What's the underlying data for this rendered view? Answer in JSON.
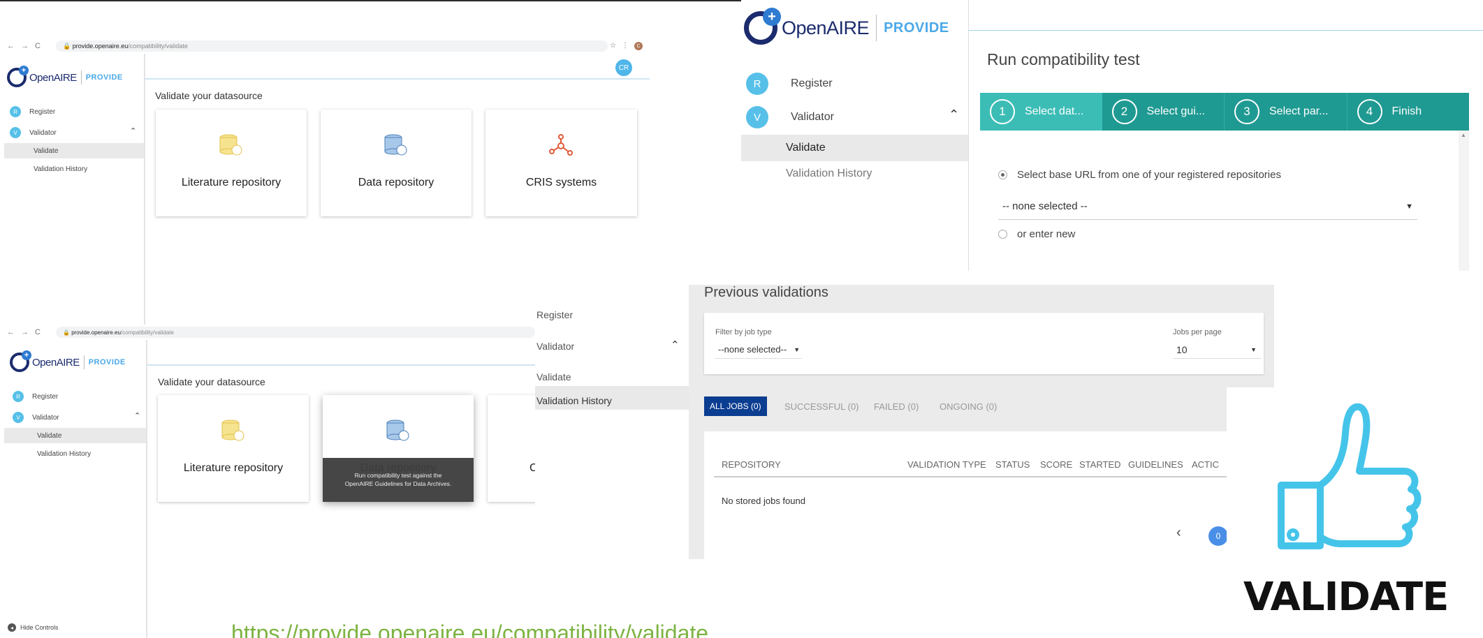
{
  "browser": {
    "url_host": "provide.openaire.eu",
    "url_path": "/compatibility/validate",
    "profile_initial": "C"
  },
  "logo": {
    "brand": "OpenAIRE",
    "product": "PROVIDE",
    "plus": "+"
  },
  "sidebar": {
    "register": {
      "badge": "R",
      "label": "Register"
    },
    "validator": {
      "badge": "V",
      "label": "Validator"
    },
    "validate": "Validate",
    "history": "Validation History"
  },
  "user_avatar": "CR",
  "validate_page": {
    "heading": "Validate your datasource",
    "cards": [
      "Literature repository",
      "Data repository",
      "CRIS systems"
    ],
    "cris_partial": "C",
    "tooltip": "Run compatibility test against the OpenAIRE Guidelines for Data Archives."
  },
  "hide_controls": "Hide Controls",
  "wizard": {
    "title": "Run compatibility test",
    "steps": [
      {
        "num": "1",
        "label": "Select dat..."
      },
      {
        "num": "2",
        "label": "Select gui..."
      },
      {
        "num": "3",
        "label": "Select par..."
      },
      {
        "num": "4",
        "label": "Finish"
      }
    ],
    "option1": "Select base URL from one of your registered repositories",
    "select_value": "-- none selected --",
    "option2": "or enter new"
  },
  "previous": {
    "title": "Previous validations",
    "filter_label": "Filter by job type",
    "filter_value": "--none selected--",
    "jobs_label": "Jobs per page",
    "jobs_value": "10",
    "tabs": [
      "ALL JOBS (0)",
      "SUCCESSFUL (0)",
      "FAILED (0)",
      "ONGOING (0)"
    ],
    "columns": [
      "REPOSITORY",
      "VALIDATION TYPE",
      "STATUS",
      "SCORE",
      "STARTED",
      "GUIDELINES",
      "ACTIC"
    ],
    "empty": "No stored jobs found",
    "page": "0",
    "prev": "‹"
  },
  "footer_url": "https://provide.openaire.eu/compatibility/validate",
  "validate_word": "VALIDATE",
  "colors": {
    "teal": "#3bbdb6",
    "teal_dark": "#1f9a92",
    "accent": "#0b3d91",
    "green_url": "#7cb342"
  }
}
